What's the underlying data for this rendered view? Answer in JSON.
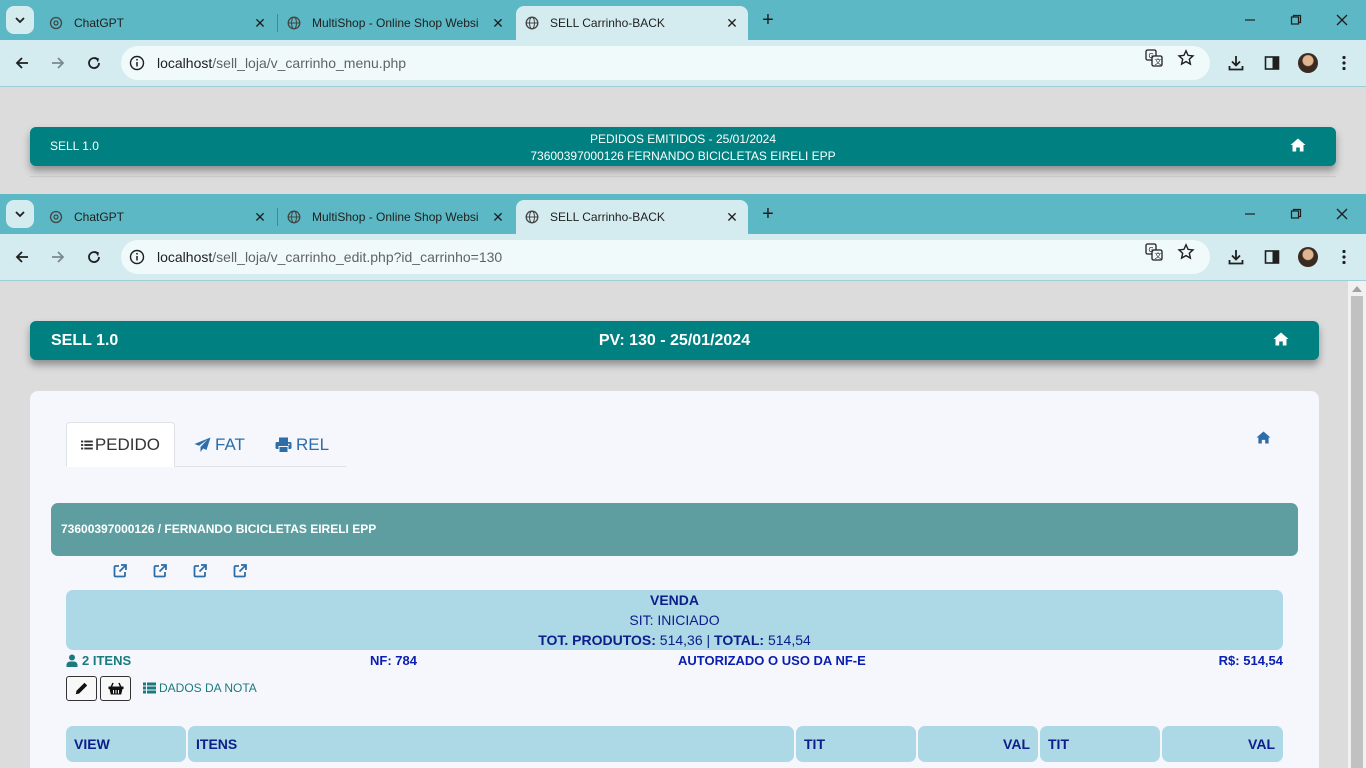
{
  "browser_top": {
    "tabs": [
      {
        "title": "ChatGPT",
        "icon": "chatgpt-icon",
        "active": false
      },
      {
        "title": "MultiShop - Online Shop Websi",
        "icon": "globe-icon",
        "active": false
      },
      {
        "title": "SELL Carrinho-BACK",
        "icon": "globe-icon",
        "active": true
      }
    ],
    "url_host": "localhost",
    "url_path": "/sell_loja/v_carrinho_menu.php"
  },
  "page1": {
    "brand": "SELL 1.0",
    "line1": "PEDIDOS EMITIDOS - 25/01/2024",
    "line2": "73600397000126 FERNANDO BICICLETAS EIRELI EPP"
  },
  "browser_bottom": {
    "tabs": [
      {
        "title": "ChatGPT",
        "icon": "chatgpt-icon",
        "active": false
      },
      {
        "title": "MultiShop - Online Shop Websi",
        "icon": "globe-icon",
        "active": false
      },
      {
        "title": "SELL Carrinho-BACK",
        "icon": "globe-icon",
        "active": true
      }
    ],
    "url_host": "localhost",
    "url_path": "/sell_loja/v_carrinho_edit.php?id_carrinho=130"
  },
  "page2": {
    "brand": "SELL 1.0",
    "title": "PV: 130 - 25/01/2024",
    "tabs": [
      {
        "label": "PEDIDO",
        "icon": "list-icon",
        "active": true
      },
      {
        "label": "FAT",
        "icon": "paper-plane-icon",
        "active": false
      },
      {
        "label": "REL",
        "icon": "printer-icon",
        "active": false
      }
    ],
    "client": "73600397000126 / FERNANDO BICICLETAS EIRELI EPP",
    "venda": {
      "title": "VENDA",
      "sit": "SIT: INICIADO",
      "tot_produtos_label": "TOT. PRODUTOS:",
      "tot_produtos_value": "514,36",
      "sep": "|",
      "total_label": "TOTAL:",
      "total_value": "514,54"
    },
    "info": {
      "itens": "2 ITENS",
      "nf": "NF: 784",
      "status": "AUTORIZADO O USO DA NF-E",
      "rs": "R$: 514,54"
    },
    "dados_nota": "DADOS DA NOTA",
    "table_headers": [
      "VIEW",
      "ITENS",
      "TIT",
      "VAL",
      "TIT",
      "VAL"
    ]
  },
  "colors": {
    "header_teal": "#008080",
    "client_bar": "#5f9ea0",
    "light_blue": "#add8e6",
    "navy_text": "#0d1d8a",
    "browser_tabbar": "#5bb8c4",
    "browser_toolbar": "#d4ecef"
  }
}
